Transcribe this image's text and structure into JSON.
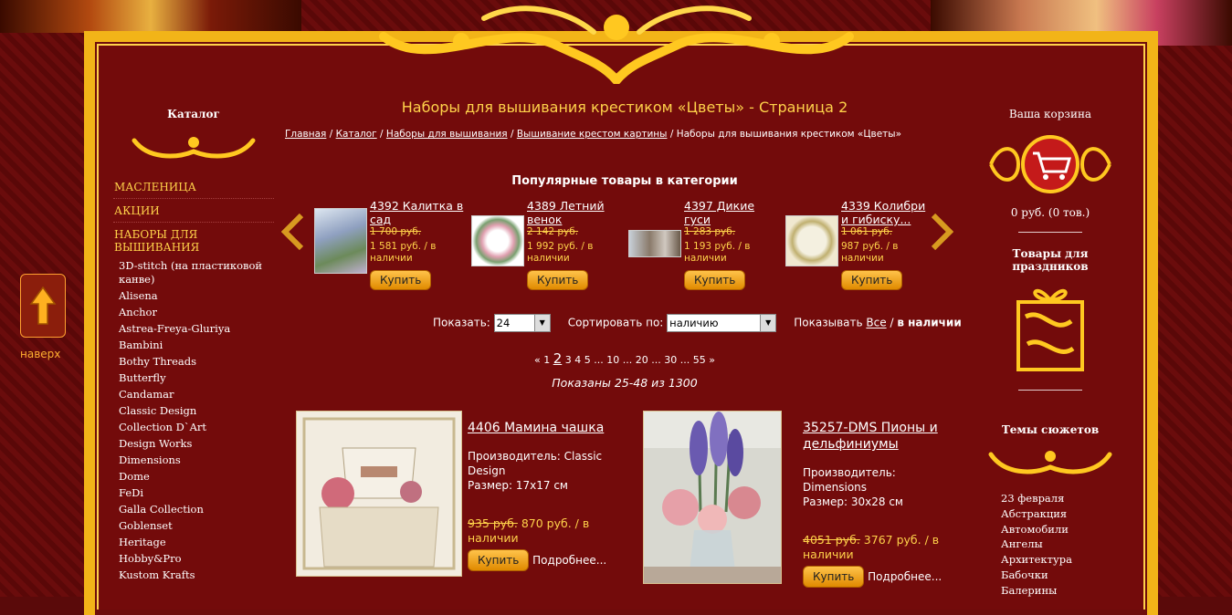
{
  "page_title": "Наборы для вышивания крестиком «Цветы» - Страница 2",
  "breadcrumbs": {
    "home": "Главная",
    "catalog": "Каталог",
    "kits": "Наборы для вышивания",
    "pictures": "Вышивание крестом картины",
    "current": "Наборы для вышивания крестиком «Цветы»",
    "sep": "/"
  },
  "left_sidebar": {
    "title": "Каталог",
    "main_items": [
      "МАСЛЕНИЦА",
      "АКЦИИ",
      "НАБОРЫ ДЛЯ ВЫШИВАНИЯ"
    ],
    "sub_items": [
      "3D-stitch (на пластиковой канве)",
      "Alisena",
      "Anchor",
      "Astrea-Freya-Gluriya",
      "Bambini",
      "Bothy Threads",
      "Butterfly",
      "Candamar",
      "Classic Design",
      "Collection D`Art",
      "Design Works",
      "Dimensions",
      "Dome",
      "FeDi",
      "Galla Collection",
      "Goblenset",
      "Heritage",
      "Hobby&Pro",
      "Kustom Krafts"
    ]
  },
  "back_to_top": "наверх",
  "cart": {
    "title": "Ваша корзина",
    "summary": "0 руб.   (0 тов.)"
  },
  "holidays_title": "Товары для праздников",
  "themes": {
    "title": "Темы сюжетов",
    "items": [
      "23 февраля",
      "Абстракция",
      "Автомобили",
      "Ангелы",
      "Архитектура",
      "Бабочки",
      "Балерины"
    ]
  },
  "popular": {
    "title": "Популярные товары в категории",
    "items": [
      {
        "title": "4392 Калитка в сад",
        "old": "1 700 руб.",
        "new": "1 581 руб. / в наличии",
        "buy": "Купить"
      },
      {
        "title": "4389 Летний венок",
        "old": "2 142 руб.",
        "new": "1 992 руб. / в наличии",
        "buy": "Купить"
      },
      {
        "title": "4397 Дикие гуси",
        "old": "1 283 руб.",
        "new": "1 193 руб. / в наличии",
        "buy": "Купить"
      },
      {
        "title": "4339 Колибри и гибиску...",
        "old": "1 061 руб.",
        "new": "987 руб. / в наличии",
        "buy": "Купить"
      }
    ]
  },
  "controls": {
    "show_label": "Показать:",
    "show_value": "24",
    "sort_label": "Сортировать по:",
    "sort_value": "наличию",
    "display_label": "Показывать",
    "display_all": "Все",
    "display_sep": "/",
    "display_stock": "в наличии"
  },
  "pager": {
    "prev": "«",
    "pages": [
      "1",
      "2",
      "3",
      "4",
      "5",
      "...",
      "10",
      "...",
      "20",
      "...",
      "30",
      "...",
      "55"
    ],
    "next": "»",
    "current": "2"
  },
  "shown_text": "Показаны 25-48 из 1300",
  "products": [
    {
      "title": "4406 Мамина чашка",
      "maker": "Производитель: Classic Design",
      "size": "Размер: 17x17 см",
      "old": "935 руб.",
      "new": "870 руб. / в наличии",
      "buy": "Купить",
      "more": "Подробнее..."
    },
    {
      "title": "35257-DMS Пионы и дельфиниумы",
      "maker": "Производитель: Dimensions",
      "size": "Размер: 30x28 см",
      "old": "4051 руб.",
      "new": "3767 руб. / в наличии",
      "buy": "Купить",
      "more": "Подробнее..."
    }
  ]
}
